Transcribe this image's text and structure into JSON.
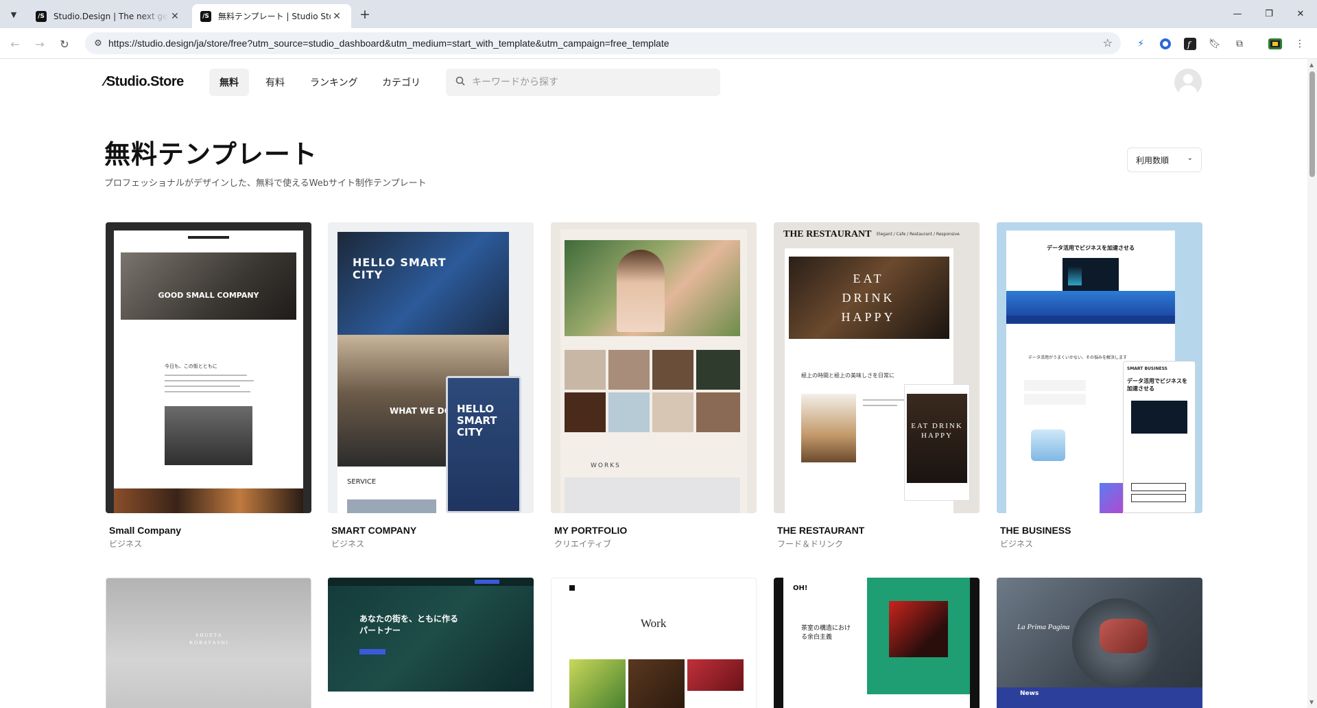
{
  "browser": {
    "tabs": [
      {
        "title": "Studio.Design | The next generation design tool",
        "active": false
      },
      {
        "title": "無料テンプレート | Studio Store",
        "active": true
      }
    ],
    "url": "https://studio.design/ja/store/free?utm_source=studio_dashboard&utm_medium=start_with_template&utm_campaign=free_template"
  },
  "site": {
    "logo": "⁄Studio.Store",
    "nav": [
      "無料",
      "有料",
      "ランキング",
      "カテゴリ"
    ],
    "search_placeholder": "キーワードから探す"
  },
  "header": {
    "title": "無料テンプレート",
    "subtitle": "プロフェッショナルがデザインした、無料で使えるWebサイト制作テンプレート",
    "sort_label": "利用数順"
  },
  "templates": [
    {
      "name": "Small Company",
      "category": "ビジネス",
      "thumb_text": "GOOD SMALL COMPANY",
      "thumb_sub": "今日も、この街とともに"
    },
    {
      "name": "SMART COMPANY",
      "category": "ビジネス",
      "thumb_text": "HELLO SMART CITY",
      "thumb_sub": "WHAT WE DO",
      "thumb_sub2": "SERVICE"
    },
    {
      "name": "MY PORTFOLIO",
      "category": "クリエイティブ",
      "thumb_text": "WORKS"
    },
    {
      "name": "THE RESTAURANT",
      "category": "フード＆ドリンク",
      "thumb_text": "THE RESTAURANT",
      "thumb_tag": "Elegant / Cafe / Restaurant / Responsive",
      "thumb_hero": "EAT DRINK HAPPY",
      "thumb_sub": "極上の時間と極上の美味しさを日常に"
    },
    {
      "name": "THE BUSINESS",
      "category": "ビジネス",
      "thumb_text": "データ活用でビジネスを加速させる",
      "thumb_sub": "SMART BUSINESS"
    }
  ],
  "templates_row2": [
    {
      "thumb_text": "SHUETA KOBAYASHI"
    },
    {
      "thumb_text": "あなたの街を、ともに作るパートナー"
    },
    {
      "thumb_text": "Work"
    },
    {
      "thumb_text": "茶室の構造における余白主義"
    },
    {
      "thumb_text": "La Prima Pagina",
      "thumb_sub": "News"
    }
  ]
}
